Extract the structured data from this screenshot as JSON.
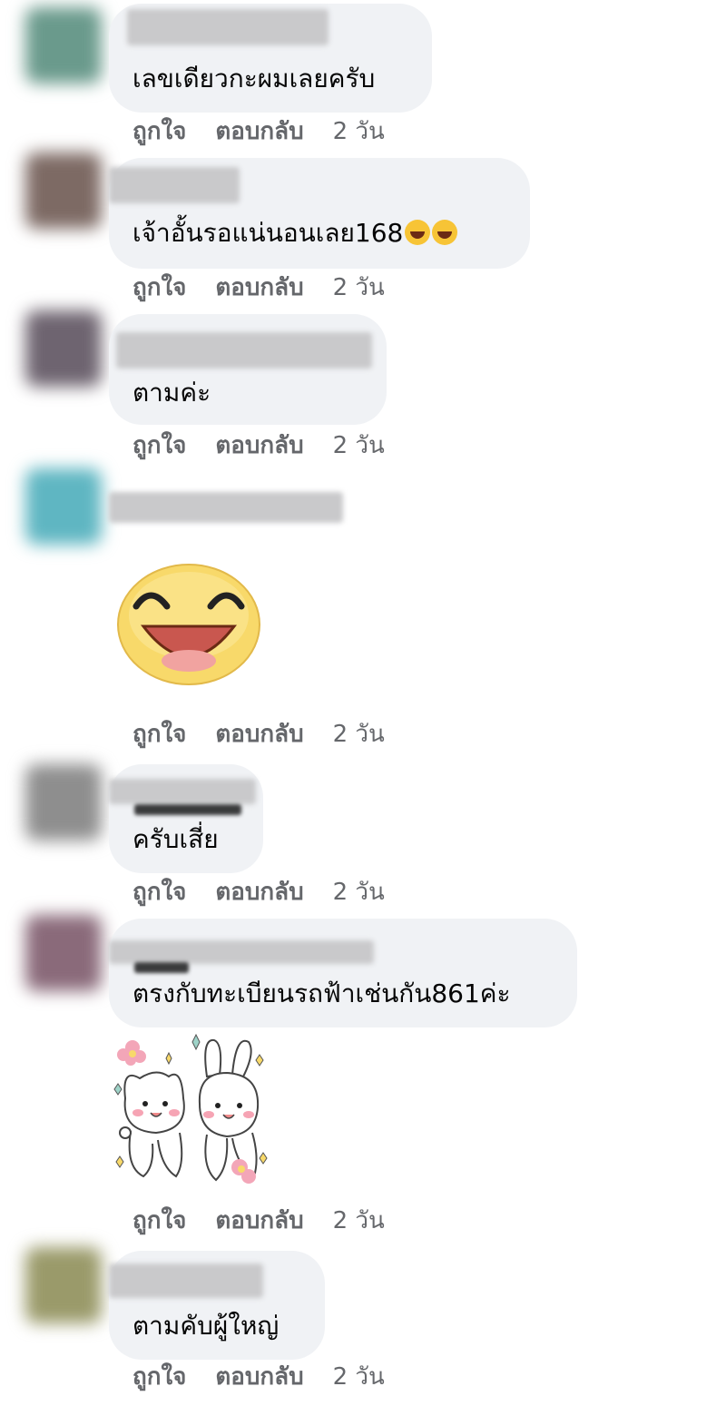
{
  "actions": {
    "like": "ถูกใจ",
    "reply": "ตอบกลับ",
    "time": "2 วัน"
  },
  "comments": [
    {
      "text": "เลขเดียวกะผมเลยครับ",
      "avatar_color": "#6a9a8c"
    },
    {
      "text": "เจ้าอั้นรอแน่นอนเลย168",
      "avatar_color": "#7d6a64",
      "emojis": [
        "grinning-sweat-emoji",
        "tears-of-joy-emoji"
      ]
    },
    {
      "text": "ตามค่ะ",
      "avatar_color": "#6e6470"
    },
    {
      "text": "",
      "avatar_color": "#5fb6c2",
      "sticker": "laughing-face-sticker"
    },
    {
      "text": "ครับเสี่ย",
      "avatar_color": "#8e8e8e"
    },
    {
      "text": "ตรงกับทะเบียนรถฟ้าเช่นกัน861ค่ะ",
      "avatar_color": "#8a6a7a",
      "sticker": "cat-bunny-sticker"
    },
    {
      "text": "ตามคับผู้ใหญ่",
      "avatar_color": "#9a9a6a"
    }
  ],
  "colors": {
    "bubble": "#f0f2f5",
    "action_text": "#65676b",
    "sticker_face": "#f8d96a",
    "sticker_mouth": "#c9574f"
  }
}
